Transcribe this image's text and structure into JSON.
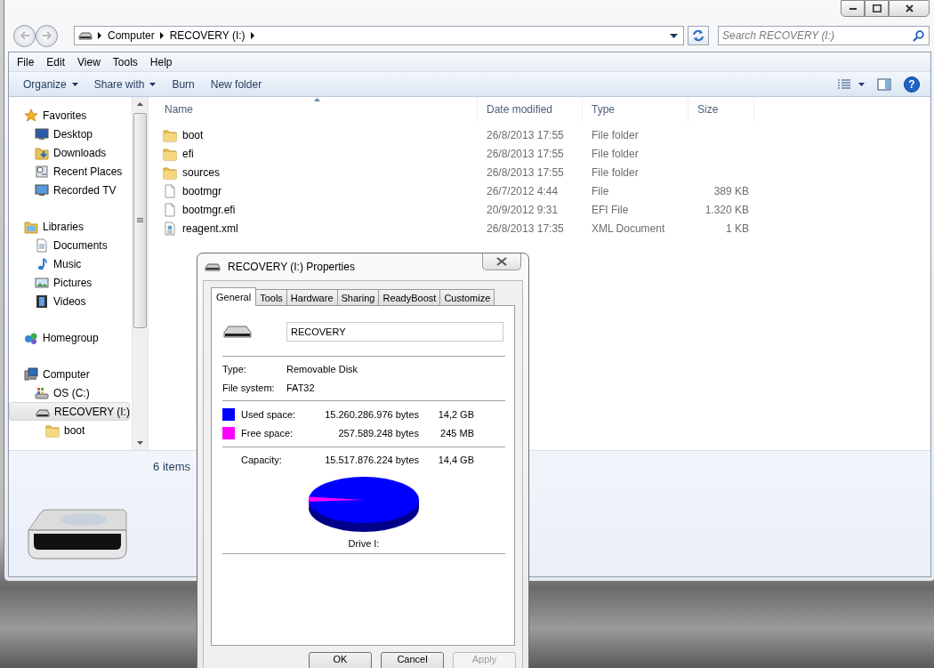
{
  "explorer": {
    "address": {
      "crumbs": [
        "Computer",
        "RECOVERY (I:)"
      ]
    },
    "search": {
      "placeholder": "Search RECOVERY (I:)"
    },
    "menu": [
      "File",
      "Edit",
      "View",
      "Tools",
      "Help"
    ],
    "toolbar": [
      {
        "label": "Organize",
        "has_menu": true
      },
      {
        "label": "Share with",
        "has_menu": true
      },
      {
        "label": "Burn",
        "has_menu": false
      },
      {
        "label": "New folder",
        "has_menu": false
      }
    ],
    "nav": [
      {
        "label": "Favorites",
        "kind": "favorites",
        "selected": false,
        "children": [
          {
            "label": "Desktop",
            "kind": "desktop",
            "selected": false
          },
          {
            "label": "Downloads",
            "kind": "downloads",
            "selected": false
          },
          {
            "label": "Recent Places",
            "kind": "recent",
            "selected": false
          },
          {
            "label": "Recorded TV",
            "kind": "tv",
            "selected": false
          }
        ]
      },
      {
        "label": "Libraries",
        "kind": "libraries",
        "selected": false,
        "children": [
          {
            "label": "Documents",
            "kind": "documents",
            "selected": false
          },
          {
            "label": "Music",
            "kind": "music",
            "selected": false
          },
          {
            "label": "Pictures",
            "kind": "pictures",
            "selected": false
          },
          {
            "label": "Videos",
            "kind": "videos",
            "selected": false
          }
        ]
      },
      {
        "label": "Homegroup",
        "kind": "homegroup",
        "selected": false
      },
      {
        "label": "Computer",
        "kind": "computer",
        "selected": false,
        "children": [
          {
            "label": "OS (C:)",
            "kind": "osdrive",
            "selected": false
          },
          {
            "label": "RECOVERY (I:)",
            "kind": "usbdrive",
            "selected": true,
            "children": [
              {
                "label": "boot",
                "kind": "folder",
                "selected": false
              }
            ]
          }
        ]
      }
    ],
    "columns": [
      {
        "label": "Name",
        "sorted": true
      },
      {
        "label": "Date modified",
        "sorted": false
      },
      {
        "label": "Type",
        "sorted": false
      },
      {
        "label": "Size",
        "sorted": false
      }
    ],
    "rows": [
      {
        "kind": "folder",
        "name": "boot",
        "date": "26/8/2013 17:55",
        "type": "File folder"
      },
      {
        "kind": "folder",
        "name": "efi",
        "date": "26/8/2013 17:55",
        "type": "File folder"
      },
      {
        "kind": "folder",
        "name": "sources",
        "date": "26/8/2013 17:55",
        "type": "File folder"
      },
      {
        "kind": "file",
        "name": "bootmgr",
        "date": "26/7/2012 4:44",
        "type": "File",
        "size": "389 KB"
      },
      {
        "kind": "file",
        "name": "bootmgr.efi",
        "date": "20/9/2012 9:31",
        "type": "EFI File",
        "size": "1.320 KB"
      },
      {
        "kind": "xml",
        "name": "reagent.xml",
        "date": "26/8/2013 17:35",
        "type": "XML Document",
        "size": "1 KB"
      }
    ],
    "help": "?",
    "status": "6 items"
  },
  "dialog": {
    "title": "RECOVERY (I:) Properties",
    "tabs": [
      {
        "label": "General",
        "selected": true
      },
      {
        "label": "Tools",
        "selected": false
      },
      {
        "label": "Hardware",
        "selected": false
      },
      {
        "label": "Sharing",
        "selected": false
      },
      {
        "label": "ReadyBoost",
        "selected": false
      },
      {
        "label": "Customize",
        "selected": false
      }
    ],
    "label_field": {
      "value": "RECOVERY"
    },
    "info": [
      {
        "label": "Type:",
        "value": "Removable Disk"
      },
      {
        "label": "File system:",
        "value": "FAT32"
      }
    ],
    "space": [
      {
        "label": "Used space:",
        "bytes": "15.260.286.976 bytes",
        "size": "14,2 GB",
        "color": "#0000ff"
      },
      {
        "label": "Free space:",
        "bytes": "257.589.248 bytes",
        "size": "245 MB",
        "color": "#ff00ff"
      }
    ],
    "capacity": {
      "label": "Capacity:",
      "bytes": "15.517.876.224 bytes",
      "size": "14,4 GB"
    },
    "drive_label": "Drive I:",
    "buttons": [
      {
        "label": "OK",
        "disabled": false
      },
      {
        "label": "Cancel",
        "disabled": false
      },
      {
        "label": "Apply",
        "disabled": true
      }
    ]
  }
}
